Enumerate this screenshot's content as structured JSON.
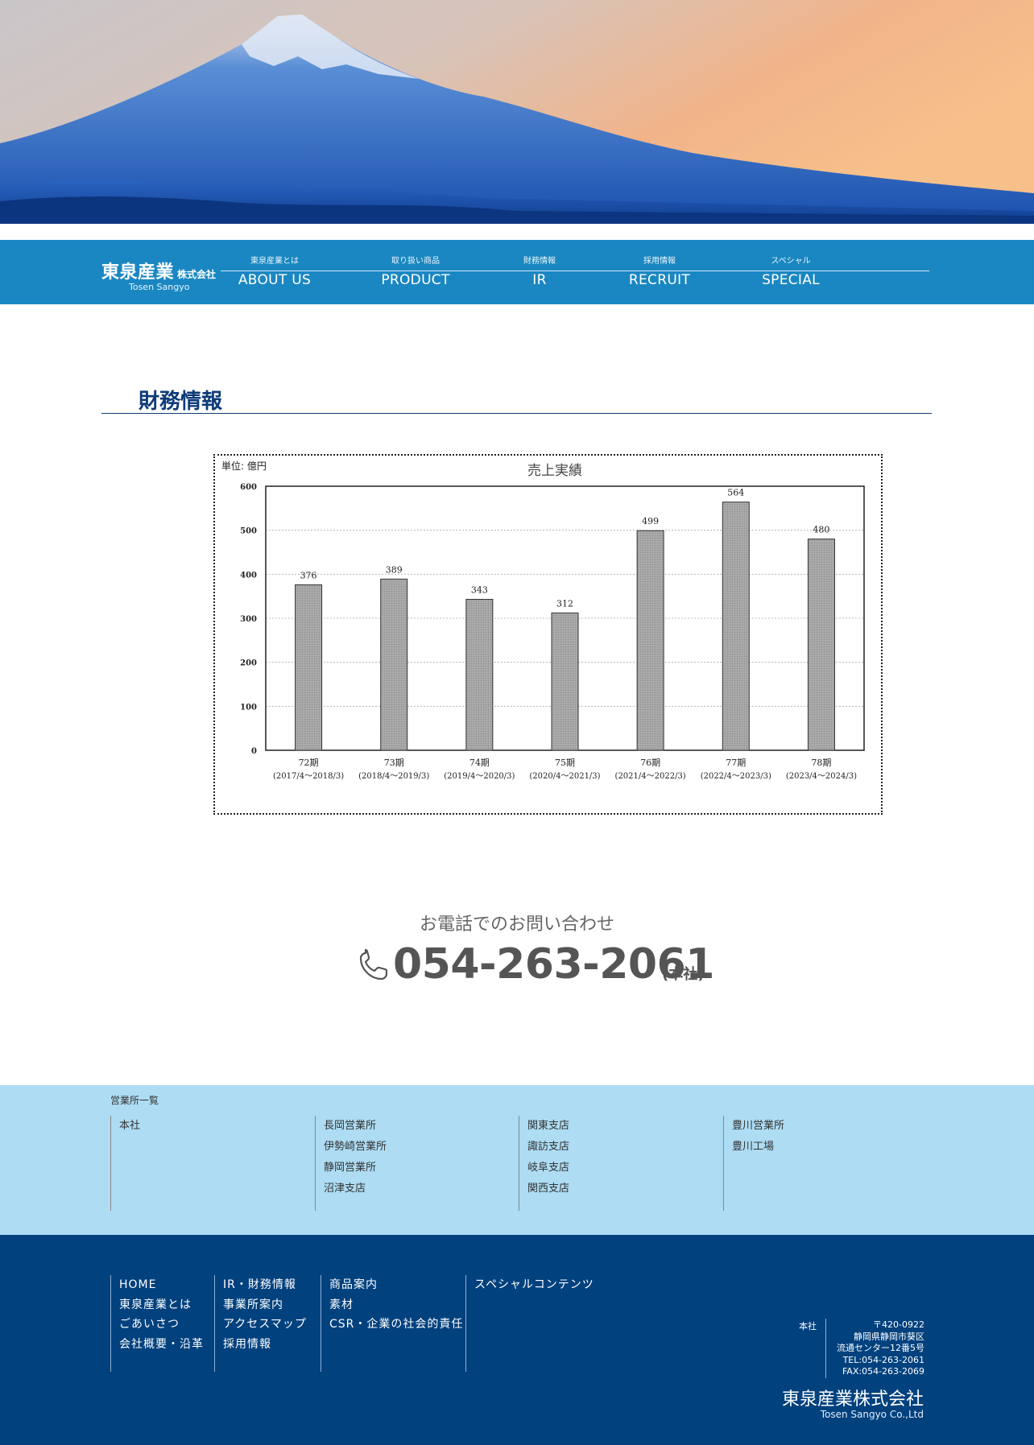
{
  "colors": {
    "nav_bg": "#1a87c2",
    "title": "#0d3b78",
    "branches_bg": "#addcf3",
    "footer_bg": "#00417e",
    "bar_fill": "#a9a9a9"
  },
  "header": {
    "hero_image": "Mount Fuji at dawn (hero photo)"
  },
  "nav": {
    "logo_jp": "東泉産業",
    "logo_suffix": "株式会社",
    "logo_en": "Tosen Sangyo",
    "items": [
      {
        "jp": "東泉産業とは",
        "en": "ABOUT US"
      },
      {
        "jp": "取り扱い商品",
        "en": "PRODUCT"
      },
      {
        "jp": "財務情報",
        "en": "IR"
      },
      {
        "jp": "採用情報",
        "en": "RECRUIT"
      },
      {
        "jp": "スペシャル",
        "en": "SPECIAL"
      }
    ]
  },
  "page": {
    "title": "財務情報"
  },
  "chart_data": {
    "type": "bar",
    "title": "売上実績",
    "unit_label": "単位: 億円",
    "categories": [
      "72期",
      "73期",
      "74期",
      "75期",
      "76期",
      "77期",
      "78期"
    ],
    "category_sub": [
      "(2017/4〜2018/3)",
      "(2018/4〜2019/3)",
      "(2019/4〜2020/3)",
      "(2020/4〜2021/3)",
      "(2021/4〜2022/3)",
      "(2022/4〜2023/3)",
      "(2023/4〜2024/3)"
    ],
    "values": [
      376,
      389,
      343,
      312,
      499,
      564,
      480
    ],
    "ylim": [
      0,
      600
    ],
    "yticks": [
      0,
      100,
      200,
      300,
      400,
      500,
      600
    ],
    "xlabel": "",
    "ylabel": "",
    "grid": true,
    "legend": "none"
  },
  "contact": {
    "label": "お電話でのお問い合わせ",
    "phone": "054-263-2061",
    "note": "(本社)",
    "icon": "phone-icon"
  },
  "branches": {
    "title": "営業所一覧",
    "columns": [
      [
        "本社"
      ],
      [
        "長岡営業所",
        "伊勢崎営業所",
        "静岡営業所",
        "沼津支店"
      ],
      [
        "関東支店",
        "諏訪支店",
        "岐阜支店",
        "関西支店"
      ],
      [
        "豊川営業所",
        "豊川工場"
      ]
    ]
  },
  "footer": {
    "columns": [
      [
        "HOME",
        "東泉産業とは",
        "ごあいさつ",
        "会社概要・沿革"
      ],
      [
        "IR・財務情報",
        "事業所案内",
        "アクセスマップ",
        "採用情報"
      ],
      [
        "商品案内",
        "素材",
        "CSR・企業の社会的責任"
      ],
      [
        "スペシャルコンテンツ"
      ]
    ],
    "hq_label": "本社",
    "hq_address": [
      "〒420-0922",
      "静岡県静岡市葵区",
      "流通センター12番5号",
      "TEL:054-263-2061",
      "FAX:054-263-2069"
    ],
    "company_jp": "東泉産業株式会社",
    "company_en": "Tosen Sangyo Co.,Ltd"
  }
}
